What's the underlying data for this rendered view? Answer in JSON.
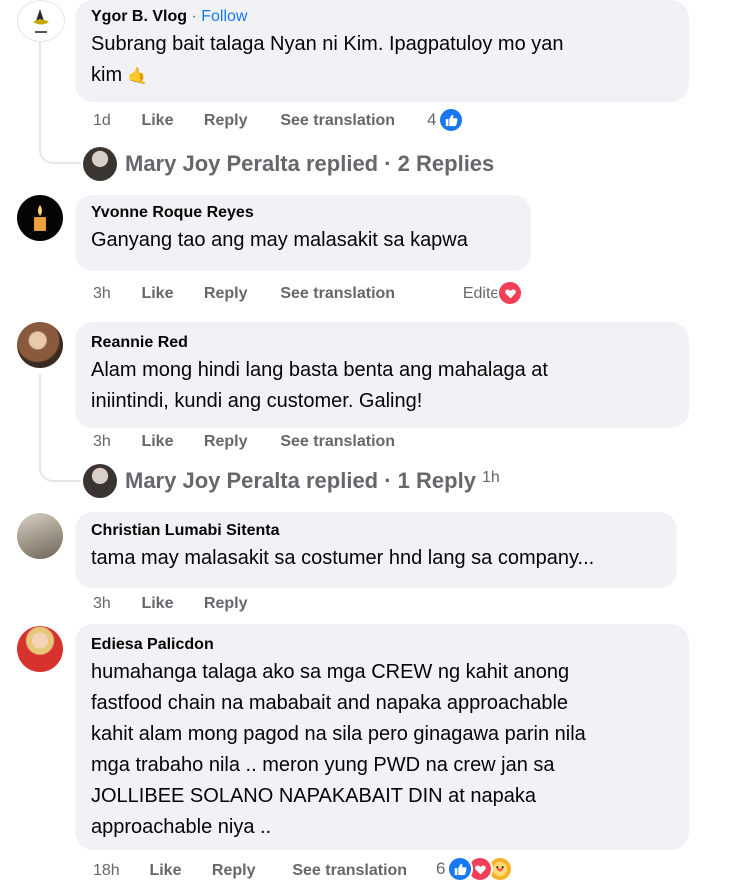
{
  "comments": [
    {
      "author": "Ygor B. Vlog",
      "follow_separator": "·",
      "follow": "Follow",
      "text_line1": "Subrang bait talaga Nyan ni Kim. Ipagpatuloy mo yan",
      "text_line2": "kim",
      "emoji": "🤙",
      "time": "1d",
      "like": "Like",
      "reply": "Reply",
      "see_translation": "See translation",
      "reaction_count": "4",
      "reactions": [
        "like-icon"
      ]
    },
    {
      "author": "Yvonne Roque Reyes",
      "text": "Ganyang tao ang may malasakit sa kapwa",
      "time": "3h",
      "like": "Like",
      "reply": "Reply",
      "see_translation": "See translation",
      "edited": "Edited",
      "reactions": [
        "heart-icon"
      ]
    },
    {
      "author": "Reannie Red",
      "text_line1": "Alam mong hindi lang basta benta ang mahalaga at",
      "text_line2": "iniintindi, kundi ang customer. Galing!",
      "time": "3h",
      "like": "Like",
      "reply": "Reply",
      "see_translation": "See translation"
    },
    {
      "author": "Christian Lumabi Sitenta",
      "text": "tama may malasakit sa costumer hnd lang sa company...",
      "time": "3h",
      "like": "Like",
      "reply": "Reply"
    },
    {
      "author": "Ediesa Palicdon",
      "lines": [
        "humahanga talaga ako sa mga CREW ng kahit anong",
        "fastfood chain na mababait and napaka approachable",
        "kahit alam mong pagod na sila pero ginagawa parin nila",
        "mga trabaho nila .. meron yung PWD na crew jan sa",
        "JOLLIBEE SOLANO NAPAKABAIT DIN at napaka",
        "approachable niya .."
      ],
      "time": "18h",
      "like": "Like",
      "reply": "Reply",
      "see_translation": "See translation",
      "reaction_count": "6",
      "reactions": [
        "like-icon",
        "heart-icon",
        "care-icon"
      ]
    }
  ],
  "replies": [
    {
      "text": "Mary Joy Peralta replied · 2 Replies",
      "time": ""
    },
    {
      "text": "Mary Joy Peralta replied · 1 Reply",
      "time": "1h"
    }
  ],
  "colors": {
    "like_blue": "#1877f2",
    "heart_red": "#f33e58",
    "care_yellow": "#f7b125",
    "meta_gray": "#65676b",
    "bubble": "#f0f2f5"
  }
}
